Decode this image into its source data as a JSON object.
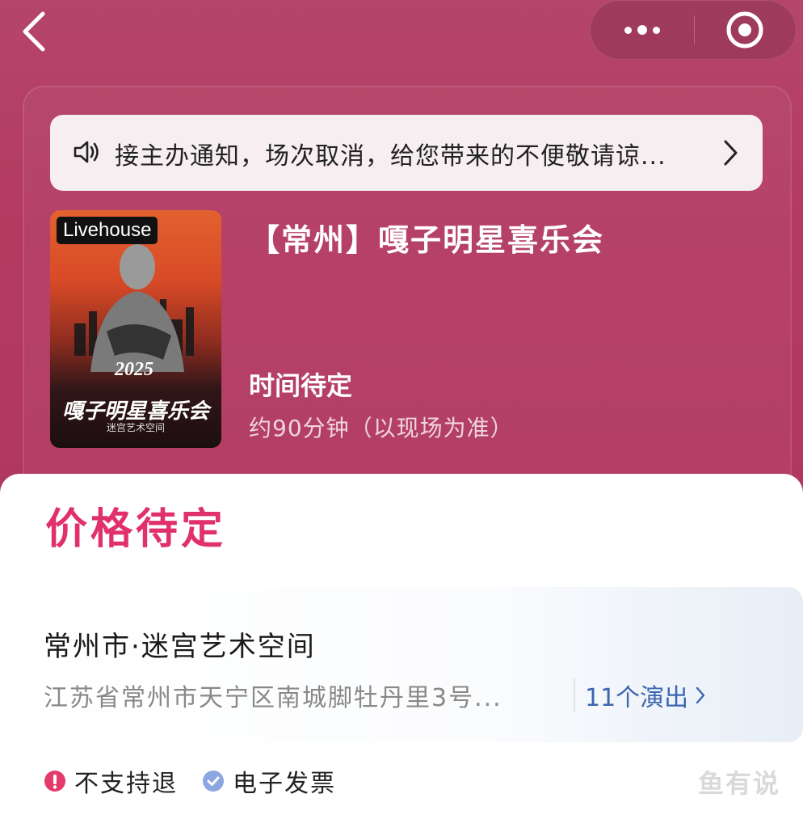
{
  "nav": {
    "back_icon": "chevron-left-icon",
    "more_icon": "more-dots-icon",
    "target_icon": "target-icon"
  },
  "notice": {
    "icon": "speaker-icon",
    "text": "接主办通知，场次取消，给您带来的不便敬请谅...",
    "chevron_icon": "chevron-right-icon"
  },
  "poster": {
    "tag": "Livehouse",
    "year": "2025",
    "title": "嘎子明星喜乐会",
    "subtitle": "迷宫艺术空间"
  },
  "show": {
    "title": "【常州】嘎子明星喜乐会",
    "time": "时间待定",
    "duration": "约90分钟（以现场为准）"
  },
  "price": "价格待定",
  "venue": {
    "name": "常州市·迷宫艺术空间",
    "address": "江苏省常州市天宁区南城脚牡丹里3号...",
    "shows_link": "11个演出"
  },
  "tags": [
    {
      "label": "不支持退",
      "icon": "exclamation-circle-icon",
      "color": "#e43b6b"
    },
    {
      "label": "电子发票",
      "icon": "check-circle-icon",
      "color": "#8ba6e0"
    }
  ],
  "watermark": "鱼有说",
  "colors": {
    "header_bg": "#b43d63",
    "price": "#e0316b",
    "link": "#3c66b0"
  }
}
